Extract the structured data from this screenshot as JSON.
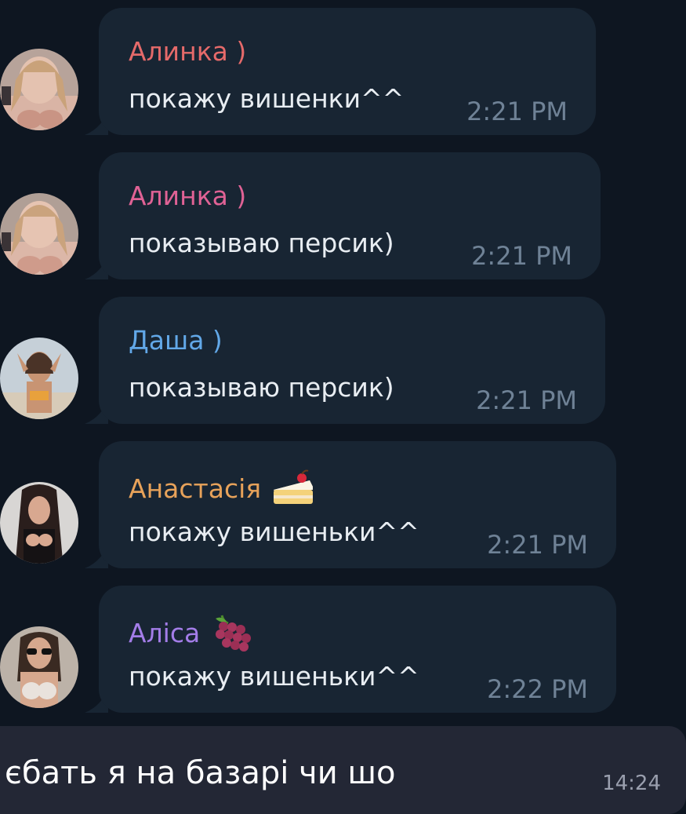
{
  "messages": [
    {
      "sender": "Алинка )",
      "sender_color": "#e56a6a",
      "text": "покажу вишенки^^",
      "time": "2:21 PM",
      "emoji": null
    },
    {
      "sender": "Алинка )",
      "sender_color": "#e06295",
      "text": "показываю персик)",
      "time": "2:21 PM",
      "emoji": null
    },
    {
      "sender": "Даша )",
      "sender_color": "#62a8e8",
      "text": "показываю персик)",
      "time": "2:21 PM",
      "emoji": null
    },
    {
      "sender": "Анастасія",
      "sender_color": "#e7a25a",
      "text": "покажу вишеньки^^",
      "time": "2:21 PM",
      "emoji": "cake-icon"
    },
    {
      "sender": "Аліса",
      "sender_color": "#a37de8",
      "text": "покажу вишеньки^^",
      "time": "2:22 PM",
      "emoji": "grapes-icon"
    }
  ],
  "reply": {
    "text": "єбать я на базарі чи шо",
    "time": "14:24"
  },
  "colors": {
    "background": "#0e1621",
    "bubble": "#182533",
    "reply_bar": "#232735",
    "time": "#6f8296"
  }
}
